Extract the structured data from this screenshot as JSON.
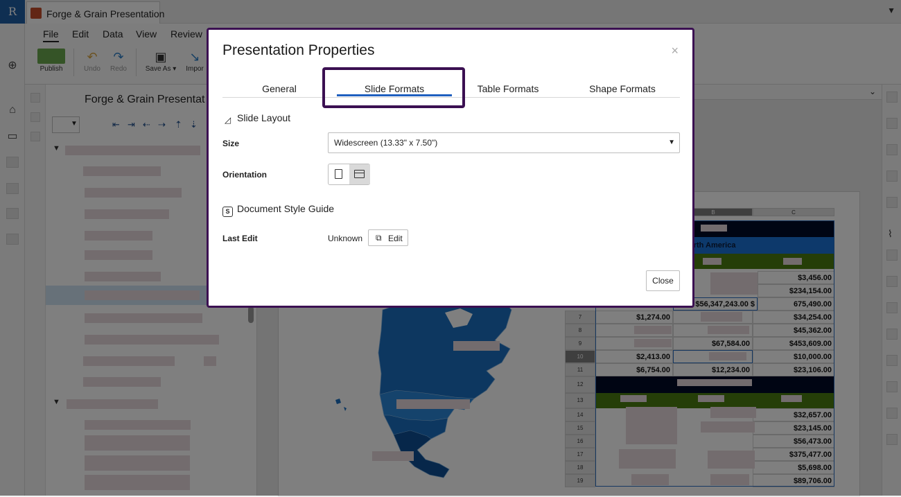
{
  "app": {
    "logo_letter": "R"
  },
  "document_tab": {
    "title": "Forge & Grain Presentation"
  },
  "menu": [
    "File",
    "Edit",
    "Data",
    "View",
    "Review"
  ],
  "ribbon": {
    "publish": "Publish",
    "undo": "Undo",
    "redo": "Redo",
    "save_as": "Save As ▾",
    "import": "Impor"
  },
  "outline": {
    "title": "Forge & Grain Presentat"
  },
  "sheet": {
    "columns": [
      "B",
      "C"
    ],
    "region_label": "orth America",
    "rows": [
      {
        "n": "",
        "a": "",
        "b": "",
        "c": "$3,456.00"
      },
      {
        "n": "",
        "a": "",
        "b": "",
        "c": "$234,154.00"
      },
      {
        "n": "",
        "a": "",
        "b": "$56,347,243.00 $",
        "c": "675,490.00"
      },
      {
        "n": "7",
        "a": "$1,274.00",
        "b": "",
        "c": "$34,254.00"
      },
      {
        "n": "8",
        "a": "",
        "b": "",
        "c": "$45,362.00"
      },
      {
        "n": "9",
        "a": "",
        "b": "$67,584.00",
        "c": "$453,609.00"
      },
      {
        "n": "10",
        "a": "$2,413.00",
        "b": "",
        "c": "$10,000.00"
      },
      {
        "n": "11",
        "a": "$6,754.00",
        "b": "$12,234.00",
        "c": "$23,106.00"
      }
    ],
    "rows2": [
      {
        "n": "14",
        "c": "$32,657.00"
      },
      {
        "n": "15",
        "c": "$23,145.00"
      },
      {
        "n": "16",
        "c": "$56,473.00"
      },
      {
        "n": "17",
        "c": "$375,477.00"
      },
      {
        "n": "18",
        "c": "$5,698.00"
      },
      {
        "n": "19",
        "c": "$89,706.00"
      }
    ],
    "band_rows": {
      "r12": "12",
      "r13": "13"
    }
  },
  "dialog": {
    "title": "Presentation Properties",
    "close_x": "×",
    "tabs": [
      "General",
      "Slide Formats",
      "Table Formats",
      "Shape Formats"
    ],
    "active_tab": "Slide Formats",
    "slide_layout": {
      "heading": "Slide Layout",
      "size_label": "Size",
      "size_value": "Widescreen (13.33\" x 7.50\")",
      "orientation_label": "Orientation",
      "orientation_selected": "landscape"
    },
    "style_guide": {
      "heading": "Document Style Guide",
      "last_edit_label": "Last Edit",
      "last_edit_value": "Unknown",
      "edit_button": "Edit"
    },
    "close_button": "Close"
  },
  "colors": {
    "accent": "#1f5fbf",
    "highlight_frame": "#3b1052",
    "map_blue": "#1a6fc0",
    "publish_green": "#6aa84f"
  }
}
